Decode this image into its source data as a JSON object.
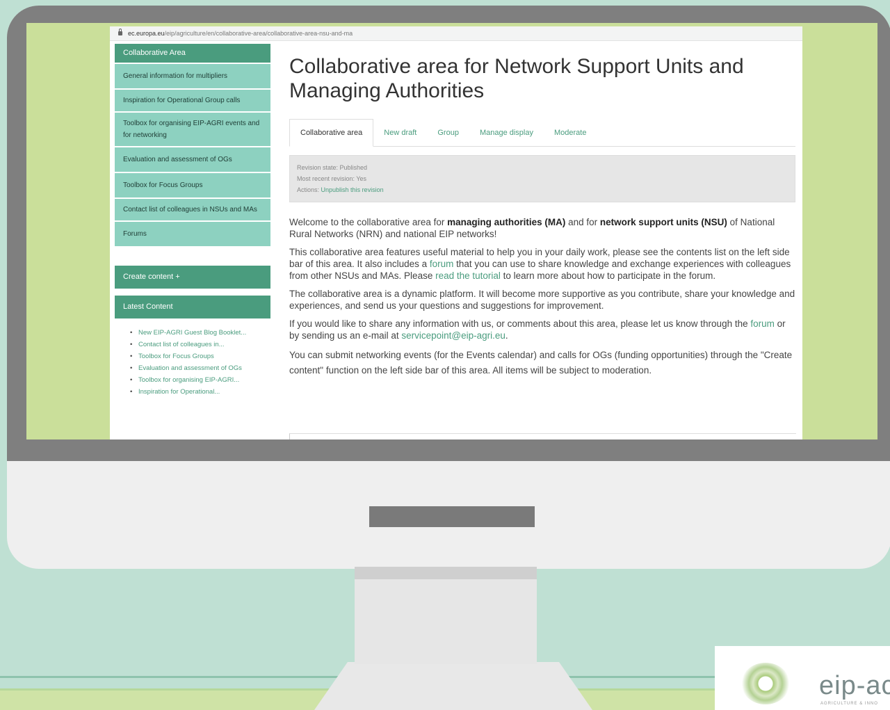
{
  "browser": {
    "url_domain": "ec.europa.eu",
    "url_path": "/eip/agriculture/en/collaborative-area/collaborative-area-nsu-and-ma"
  },
  "sidebar": {
    "header": "Collaborative Area",
    "items": [
      {
        "label": "General information for multipliers"
      },
      {
        "label": "Inspiration for Operational Group calls"
      },
      {
        "label": "Toolbox for organising EIP-AGRI events and for networking"
      },
      {
        "label": "Evaluation and assessment of OGs"
      },
      {
        "label": "Toolbox for Focus Groups"
      },
      {
        "label": "Contact list of colleagues in NSUs and MAs"
      },
      {
        "label": "Forums"
      }
    ],
    "create_content": "Create content +",
    "latest_content_header": "Latest Content",
    "latest": [
      "New EIP-AGRI Guest Blog Booklet...",
      "Contact list of colleagues in...",
      "Toolbox for Focus Groups",
      "Evaluation and assessment of OGs",
      "Toolbox for organising EIP-AGRI...",
      "Inspiration for Operational..."
    ]
  },
  "main": {
    "title": "Collaborative area for Network Support Units and Managing Authorities",
    "tabs": [
      "Collaborative area",
      "New draft",
      "Group",
      "Manage display",
      "Moderate"
    ],
    "revision": {
      "state": "Revision state: Published",
      "latest": "Most recent revision: Yes",
      "actions_label": "Actions:",
      "actions_link": "Unpublish this revision"
    },
    "p1": {
      "t1": "Welcome to the collaborative area for ",
      "b1": "managing authorities (MA)",
      "t2": " and for ",
      "b2": "network support units (NSU)",
      "t3": " of National Rural Networks (NRN) and national EIP networks!"
    },
    "p2": {
      "t1": "This collaborative area features useful material to help you in your daily work, please see the contents list on the left side bar of this area. It also includes a ",
      "l1": "forum",
      "t2": " that you can use to share knowledge and exchange experiences with colleagues from other NSUs and MAs. Please ",
      "l2": "read the tutorial",
      "t3": " to learn more about how to participate in the forum."
    },
    "p3": "The collaborative area is a dynamic platform. It will become more supportive as you contribute, share your knowledge and experiences, and send us your questions and suggestions for improvement.",
    "p4": {
      "t1": "If you would like to share any information with us, or comments about this area, please let us know through the ",
      "l1": "forum",
      "t2": " or by sending us an e-mail at ",
      "l2": "servicepoint@eip-agri.eu",
      "t3": "."
    },
    "p5": "You can submit networking events (for the Events calendar) and calls for OGs (funding opportunities) through the \"Create content\" function on the left side bar of this area. All items will be subject to moderation."
  },
  "logo": {
    "text": "eip-ac",
    "sub": "AGRICULTURE & INNO"
  }
}
